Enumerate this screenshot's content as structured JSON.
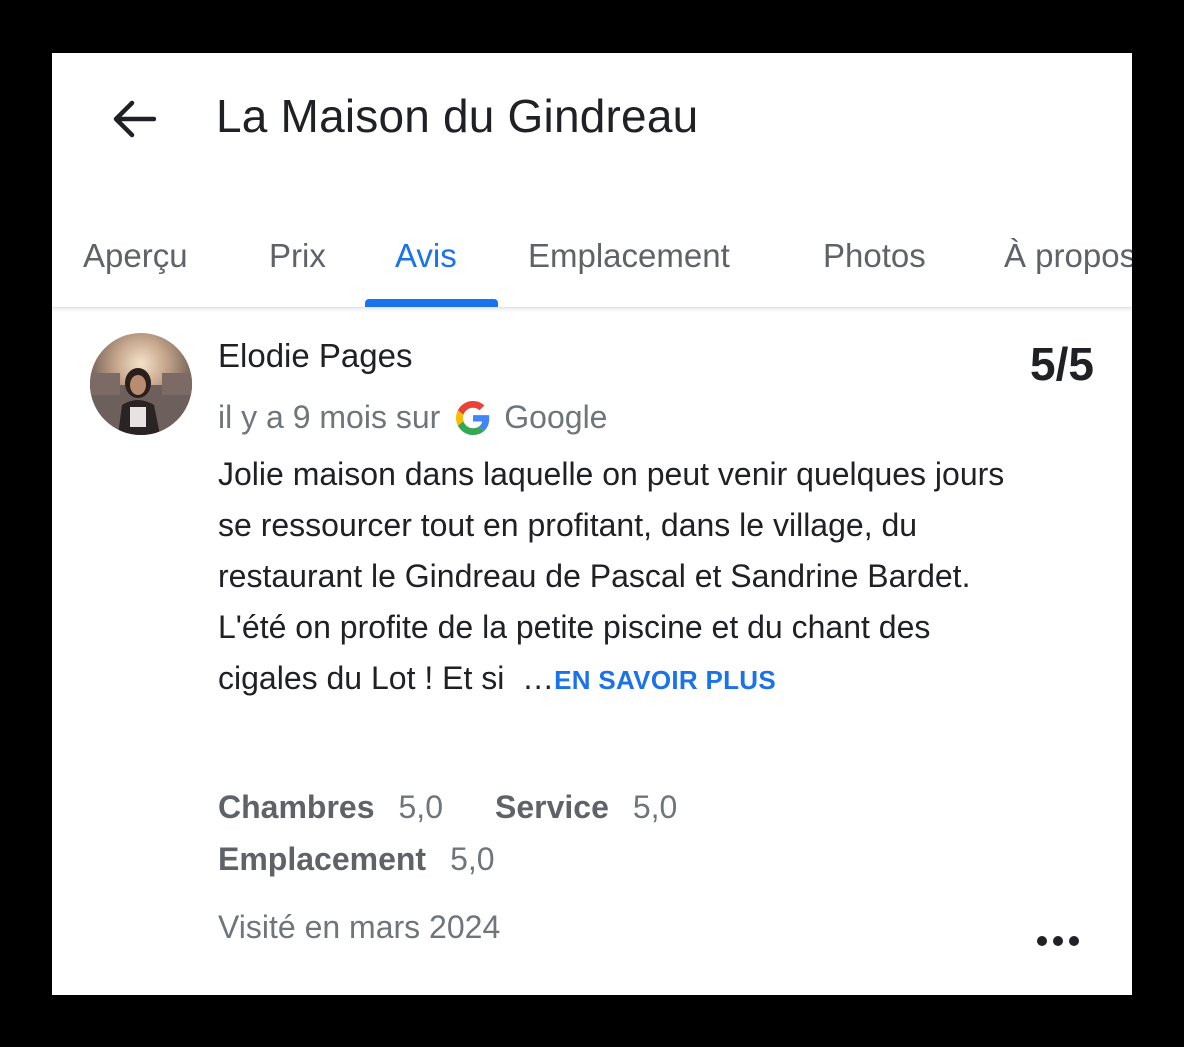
{
  "header": {
    "title": "La Maison du Gindreau",
    "back_icon": "arrow-back-icon"
  },
  "tabs": [
    {
      "label": "Aperçu",
      "active": false
    },
    {
      "label": "Prix",
      "active": false
    },
    {
      "label": "Avis",
      "active": true
    },
    {
      "label": "Emplacement",
      "active": false
    },
    {
      "label": "Photos",
      "active": false
    },
    {
      "label": "À propos",
      "active": false
    }
  ],
  "review": {
    "reviewer": "Elodie Pages",
    "rating": "5/5",
    "time": "il y a 9 mois sur",
    "source": "Google",
    "text": "Jolie maison dans laquelle on peut venir quelques jours se ressourcer tout en profitant, dans le village, du restaurant le Gindreau de Pascal et Sandrine Bardet. L'été on profite de la petite piscine et du chant des cigales du Lot ! Et si",
    "ellipsis": "…",
    "more_label": "EN SAVOIR PLUS",
    "sub_ratings": [
      {
        "label": "Chambres",
        "value": "5,0"
      },
      {
        "label": "Service",
        "value": "5,0"
      },
      {
        "label": "Emplacement",
        "value": "5,0"
      }
    ],
    "visited": "Visité en mars 2024",
    "menu_icon": "more-horiz-icon"
  },
  "colors": {
    "accent": "#1a73e8",
    "text_primary": "#202124",
    "text_secondary": "#70757a"
  }
}
